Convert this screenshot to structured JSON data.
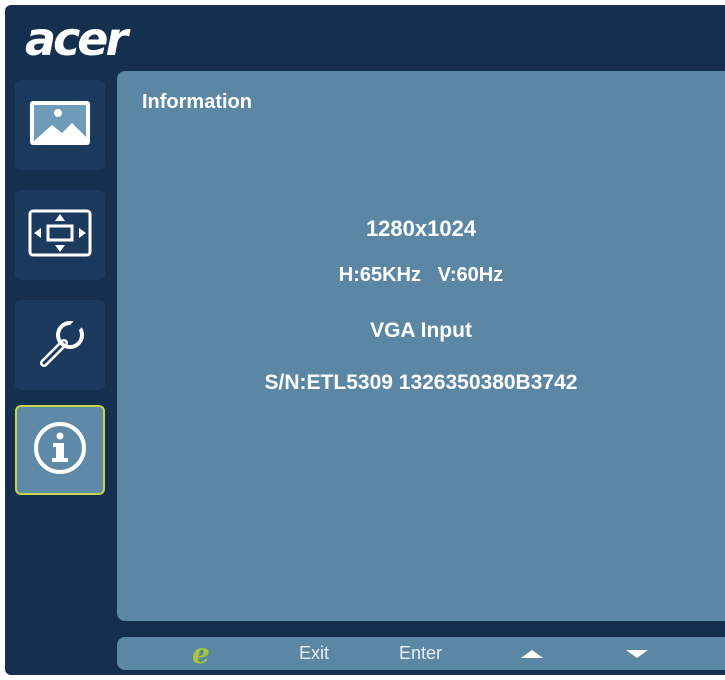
{
  "logo": "acer",
  "sidebar": {
    "items": [
      {
        "icon": "picture-icon"
      },
      {
        "icon": "osd-position-icon"
      },
      {
        "icon": "settings-wrench-icon"
      },
      {
        "icon": "information-icon",
        "selected": true
      }
    ]
  },
  "panel": {
    "title": "Information",
    "resolution": "1280x1024",
    "frequency": "H:65KHz   V:60Hz",
    "input": "VGA Input",
    "serial": "S/N:ETL5309 1326350380B3742"
  },
  "bottom_bar": {
    "e_icon": "e",
    "exit_label": "Exit",
    "enter_label": "Enter",
    "up_icon": "up-arrow-icon",
    "down_icon": "down-arrow-icon"
  },
  "colors": {
    "background": "#15304f",
    "panel": "#5b87a5",
    "selected_border": "#c8d54a",
    "e_icon": "#a9c63a"
  }
}
